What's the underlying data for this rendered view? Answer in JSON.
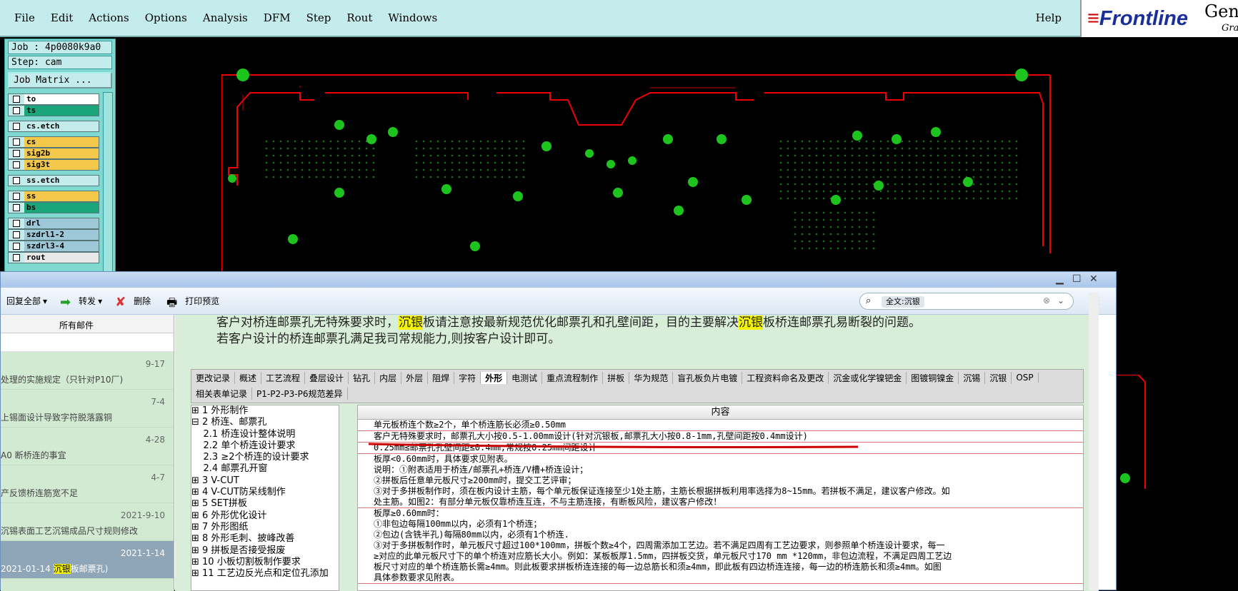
{
  "menu": {
    "items": [
      "File",
      "Edit",
      "Actions",
      "Options",
      "Analysis",
      "DFM",
      "Step",
      "Rout",
      "Windows"
    ],
    "help": "Help"
  },
  "brand": {
    "logo": "Frontline",
    "product_line1": "Gene",
    "product_line2": "Grap"
  },
  "job": {
    "job_label": "Job : 4p0080k9a0",
    "step_label": "Step: cam",
    "matrix_button": "Job Matrix ..."
  },
  "layers": [
    {
      "name": "to",
      "color": "#ffffff"
    },
    {
      "name": "ts",
      "color": "#1aa67a"
    },
    {
      "name": "cs.etch",
      "color": "#c5ecec"
    },
    {
      "name": "cs",
      "color": "#f4c84a"
    },
    {
      "name": "sig2b",
      "color": "#f4c84a"
    },
    {
      "name": "sig3t",
      "color": "#f4c84a"
    },
    {
      "name": "ss.etch",
      "color": "#c5ecec"
    },
    {
      "name": "ss",
      "color": "#f4c84a"
    },
    {
      "name": "bs",
      "color": "#1aa67a"
    },
    {
      "name": "drl",
      "color": "#9ec7d8"
    },
    {
      "name": "szdrl1-2",
      "color": "#9ec7d8"
    },
    {
      "name": "szdrl3-4",
      "color": "#9ec7d8"
    },
    {
      "name": "rout",
      "color": "#e8e8e8"
    }
  ],
  "outlook": {
    "toolbar": {
      "restore_all": "回复全部",
      "forward": "转发",
      "delete": "删除",
      "print_preview": "打印预览"
    },
    "search_chip": "全文:沉银",
    "list_header": "所有邮件",
    "mails": [
      {
        "date": "9-17",
        "subject": "处理的实施规定（只针对P10厂)"
      },
      {
        "date": "7-4",
        "subject": "上锡面设计导致字符脱落露铜"
      },
      {
        "date": "4-28",
        "subject": "A0 断桥连的事宜"
      },
      {
        "date": "4-7",
        "subject": "产反馈桥连筋宽不足"
      },
      {
        "date": "2021-9-10",
        "subject": "沉锡表面工艺沉锡成品尺寸规则修改"
      },
      {
        "date": "2021-1-14",
        "subject_prefix": "2021-01-14 ",
        "subject_hl": "沉银",
        "subject_suffix": "板邮票孔)"
      }
    ],
    "body": {
      "para1_pre": "客户对桥连邮票孔无特殊要求时，",
      "para1_hl1": "沉银",
      "para1_mid": "板请注意按最新规范优化邮票孔和孔壁间距，目的主要解决",
      "para1_hl2": "沉银",
      "para1_post": "板桥连邮票孔易断裂的问题。",
      "para2": "若客户设计的桥连邮票孔满足我司常规能力,则按客户设计即可。"
    },
    "tabs_row1": [
      "更改记录",
      "概述",
      "工艺流程",
      "叠层设计",
      "钻孔",
      "内层",
      "外层",
      "阻焊",
      "字符",
      "外形",
      "电测试",
      "重点流程制作",
      "拼板",
      "华为规范",
      "盲孔板负片电镀",
      "工程资料命名及更改",
      "沉金或化学镍钯金",
      "图镀铜镍金",
      "沉锡",
      "沉银",
      "OSP"
    ],
    "tabs_row2": [
      "相关表单记录",
      "P1-P2-P3-P6规范差异"
    ],
    "active_tab": "外形",
    "tree": [
      "⊞ 1 外形制作",
      "⊟ 2 桥连、邮票孔",
      "    2.1 桥连设计整体说明",
      "    2.2 单个桥连设计要求",
      "    2.3 ≥2个桥连的设计要求",
      "    2.4 邮票孔开窗",
      "⊞ 3 V-CUT",
      "⊞ 4 V-CUT防呆线制作",
      "⊞ 5 SET拼板",
      "⊞ 6 外形优化设计",
      "⊞ 7 外形图纸",
      "⊞ 8 外形毛刺、披峰改善",
      "⊞ 9 拼板是否接受报废",
      "⊞ 10 小板切割板制作要求",
      "⊞ 11 工艺边反光点和定位孔添加"
    ],
    "grid_header": "内容",
    "grid_rows": [
      [
        "单元板桥连个数≥2个，单个桥连筋长必须≥0.50mm"
      ],
      [
        "客户无特殊要求时，邮票孔大小按0.5-1.00mm设计(针对沉银板,邮票孔大小按0.8-1mm,孔壁间距按0.4mm设计)"
      ],
      [
        "0.25mm≤邮票孔孔壁间距≤0.4mm,常规按0.25mm间距设计"
      ],
      [
        "板厚<0.60mm时，具体要求见附表。",
        "说明：①附表适用于桥连/邮票孔+桥连/V槽+桥连设计；",
        "②拼板后任意单元板尺寸≥200mm时，提交工艺评审；",
        "③对于多拼板制作时，须在板内设计主筋，每个单元板保证连接至少1处主筋，主筋长根据拼板利用率选择为8~15mm。若拼板不满足，建议客户修改。如",
        "处主筋。如图2：有部分单元板仅靠桥连互连，不与主筋连接，有断板风险，建议客户修改！"
      ],
      [
        "板厚≥0.60mm时：",
        "①非包边每隔100mm以内，必须有1个桥连；",
        "②包边(含铣半孔)每隔80mm以内，必须有1个桥连.",
        "③对于多拼板制作时，单元板尺寸超过100*100mm，拼板个数≥4个，四周需添加工艺边。若不满足四周有工艺边要求，则参照单个桥连设计要求，每一",
        "≥对应的此单元板尺寸下的单个桥连对应筋长大小。例如：某板板厚1.5mm，四拼板交货，单元板尺寸170 mm *120mm，非包边流程，不满足四周工艺边",
        "板尺寸对应的单个桥连筋长需≥4mm。则此板要求拼板桥连连接的每一边总筋长和须≥4mm，即此板有四边桥连连接，每一边的桥连筋长和须≥4mm。如图",
        "具体参数要求见附表。"
      ]
    ]
  }
}
